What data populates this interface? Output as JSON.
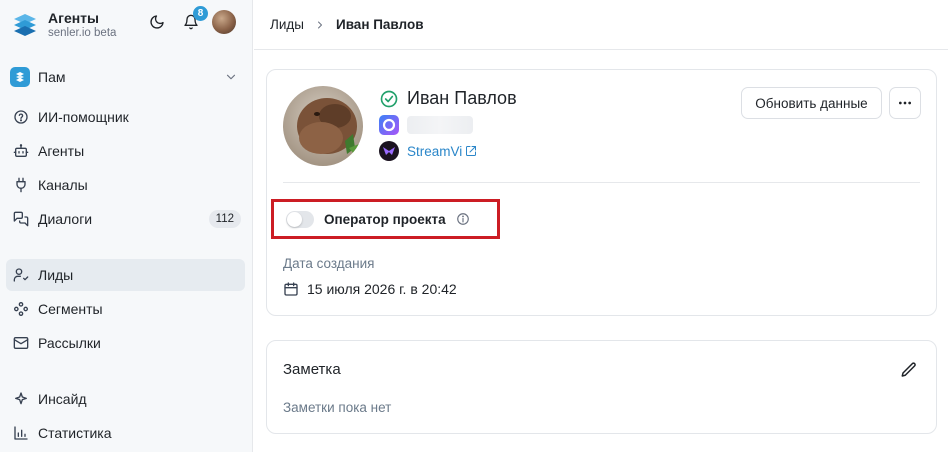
{
  "brand": {
    "title": "Агенты",
    "subtitle": "senler.io beta"
  },
  "notifications": {
    "count": "8"
  },
  "workspace": {
    "name": "Пам"
  },
  "nav": {
    "group1": [
      {
        "label": "ИИ-помощник",
        "icon": "help-circle-icon"
      },
      {
        "label": "Агенты",
        "icon": "bot-icon"
      },
      {
        "label": "Каналы",
        "icon": "plug-icon"
      },
      {
        "label": "Диалоги",
        "icon": "messages-icon",
        "count": "112"
      }
    ],
    "group2": [
      {
        "label": "Лиды",
        "icon": "user-check-icon",
        "active": true
      },
      {
        "label": "Сегменты",
        "icon": "segments-icon"
      },
      {
        "label": "Рассылки",
        "icon": "mail-icon"
      }
    ],
    "group3": [
      {
        "label": "Инсайд",
        "icon": "sparkle-icon"
      },
      {
        "label": "Статистика",
        "icon": "bar-chart-icon"
      }
    ]
  },
  "breadcrumb": {
    "parent": "Лиды",
    "current": "Иван Павлов"
  },
  "lead": {
    "name": "Иван Павлов",
    "source": "StreamVi",
    "refresh_label": "Обновить данные",
    "operator_label": "Оператор проекта",
    "operator_enabled": false,
    "created_label": "Дата создания",
    "created_value": "15 июля 2026 г. в 20:42"
  },
  "note": {
    "title": "Заметка",
    "empty_text": "Заметки пока нет"
  },
  "colors": {
    "accent": "#2f9bd6",
    "link": "#2a86c9",
    "highlight": "#cc1d24",
    "success": "#22a06b"
  }
}
